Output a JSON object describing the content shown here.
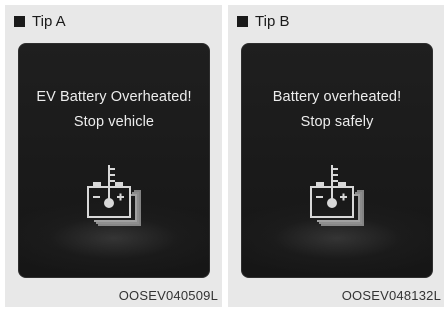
{
  "panels": [
    {
      "tip_label": "Tip A",
      "message_line1": "EV Battery Overheated!",
      "message_line2": "Stop vehicle",
      "icon": "battery-overheat-icon",
      "code": "OOSEV040509L"
    },
    {
      "tip_label": "Tip B",
      "message_line1": "Battery overheated!",
      "message_line2": "Stop safely",
      "icon": "battery-overheat-icon",
      "code": "OOSEV048132L"
    }
  ],
  "colors": {
    "panel_background": "#e8e8e8",
    "screen_background": "#1a1a1a",
    "message_text": "#ededed",
    "icon": "#d8d8d8"
  }
}
